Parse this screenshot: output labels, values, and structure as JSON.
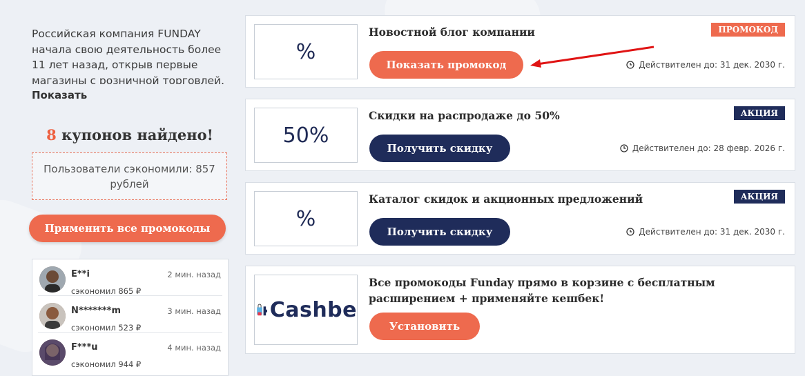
{
  "sidebar": {
    "description": "Российская компания FUNDAY начала свою деятельность более 11 лет назад, открыв первые магазины с розничной торговлей. За время",
    "show_more": "Показать",
    "coupons_count": "8",
    "coupons_found_text": " купонов найдено!",
    "saved_text": "Пользователи сэкономили: 857 рублей",
    "apply_all_label": "Применить все промокоды",
    "users": [
      {
        "name": "E**i",
        "saved": "сэкономил 865 ₽",
        "time": "2 мин. назад"
      },
      {
        "name": "N*******m",
        "saved": "сэкономил 523 ₽",
        "time": "3 мин. назад"
      },
      {
        "name": "F***u",
        "saved": "сэкономил 944 ₽",
        "time": "4 мин. назад"
      }
    ]
  },
  "offers": [
    {
      "thumb": "%",
      "title": "Новостной блог компании",
      "button": "Показать промокод",
      "badge": "ПРОМОКОД",
      "valid": "Действителен до: 31 дек. 2030 г."
    },
    {
      "thumb": "50%",
      "title": "Скидки на распродаже до 50%",
      "button": "Получить скидку",
      "badge": "АКЦИЯ",
      "valid": "Действителен до: 28 февр. 2026 г."
    },
    {
      "thumb": "%",
      "title": "Каталог скидок и акционных предложений",
      "button": "Получить скидку",
      "badge": "АКЦИЯ",
      "valid": "Действителен до: 31 дек. 2030 г."
    },
    {
      "thumb": "Cashbe",
      "title_line1": "Все промокоды Funday прямо в корзине с бесплатным",
      "title_line2": "расширением + применяйте кешбек!",
      "button": "Установить"
    }
  ],
  "colors": {
    "accent": "#ee6a4e",
    "navy": "#1f2c5a",
    "arrow": "#e01414"
  }
}
